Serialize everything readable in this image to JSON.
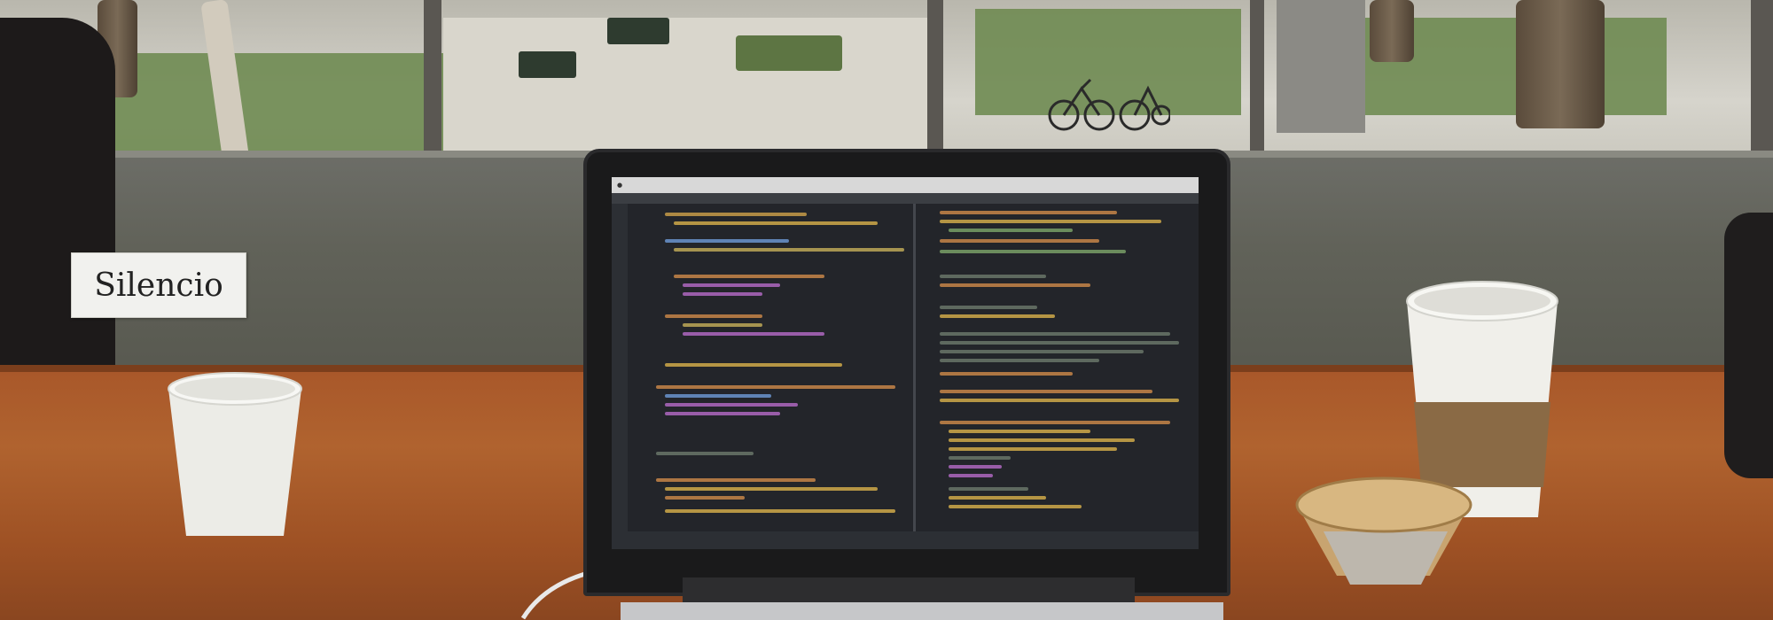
{
  "photo": {
    "sign_text": "Silencio"
  }
}
